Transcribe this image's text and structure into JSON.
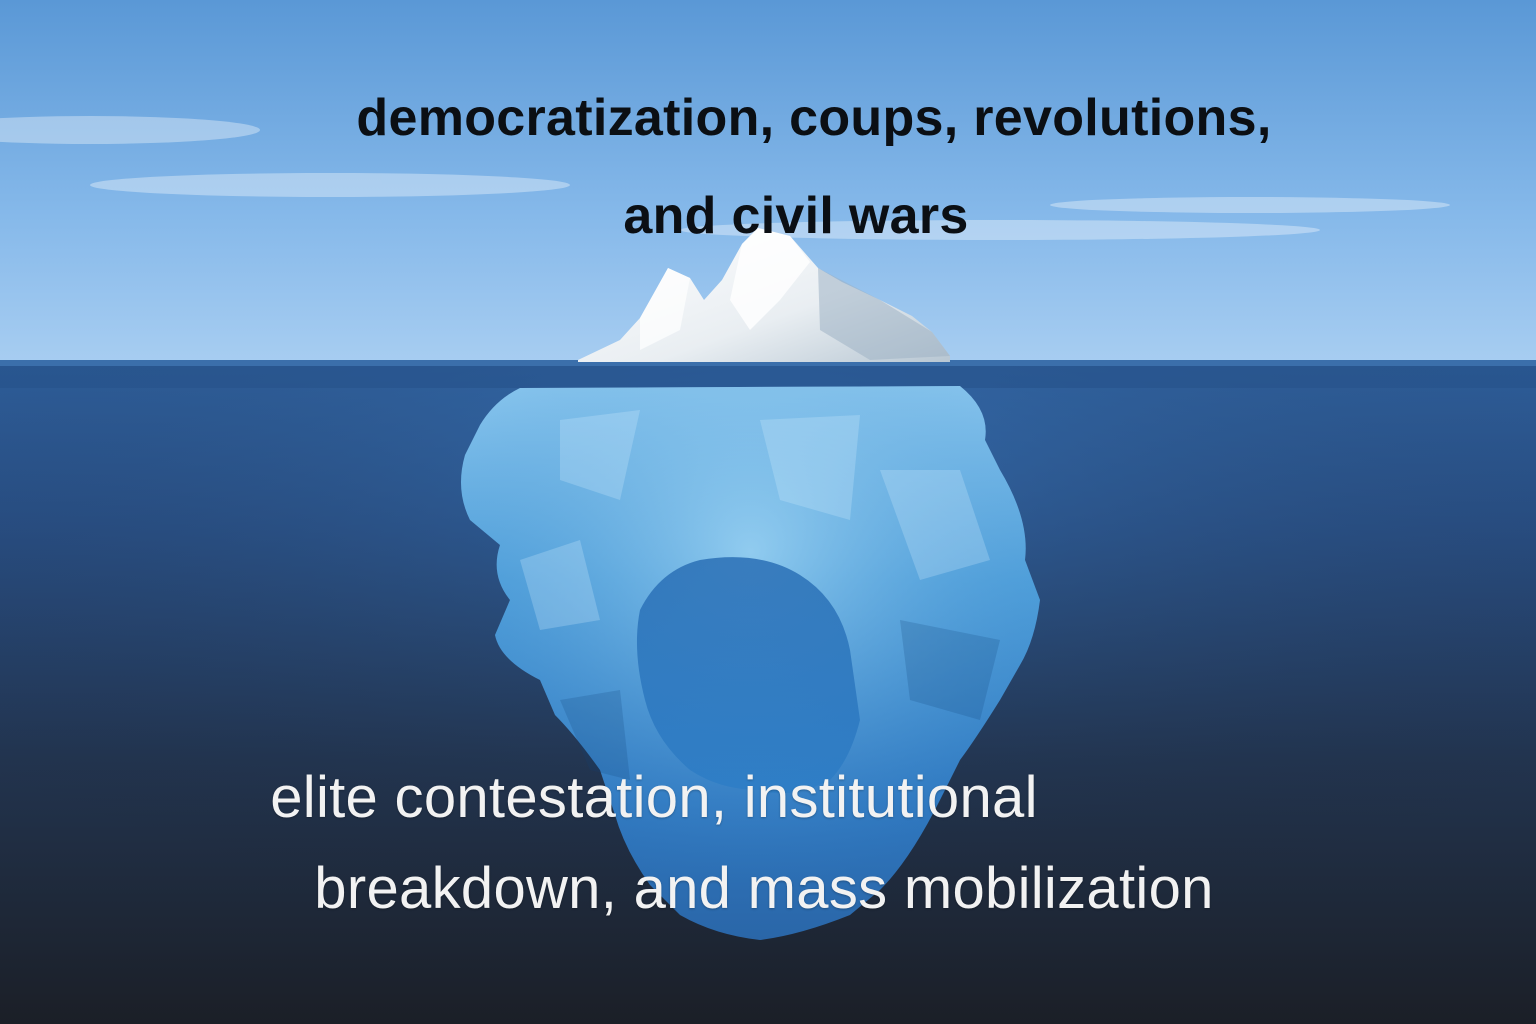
{
  "captions": {
    "above_water": {
      "line1": "democratization, coups, revolutions,",
      "line2": "and civil wars"
    },
    "below_water": {
      "line1": "elite contestation, institutional",
      "line2": "breakdown, and mass mobilization"
    }
  },
  "colors": {
    "sky_top": "#5b9ad8",
    "sky_horizon": "#9cc6ee",
    "water_surface": "#2e5f9e",
    "water_deep": "#1c2230",
    "ice_above": "#f3f6f8",
    "ice_below": "#4d9ed8",
    "caption_above": "#0b0f14",
    "caption_below": "#f2f2f2"
  }
}
